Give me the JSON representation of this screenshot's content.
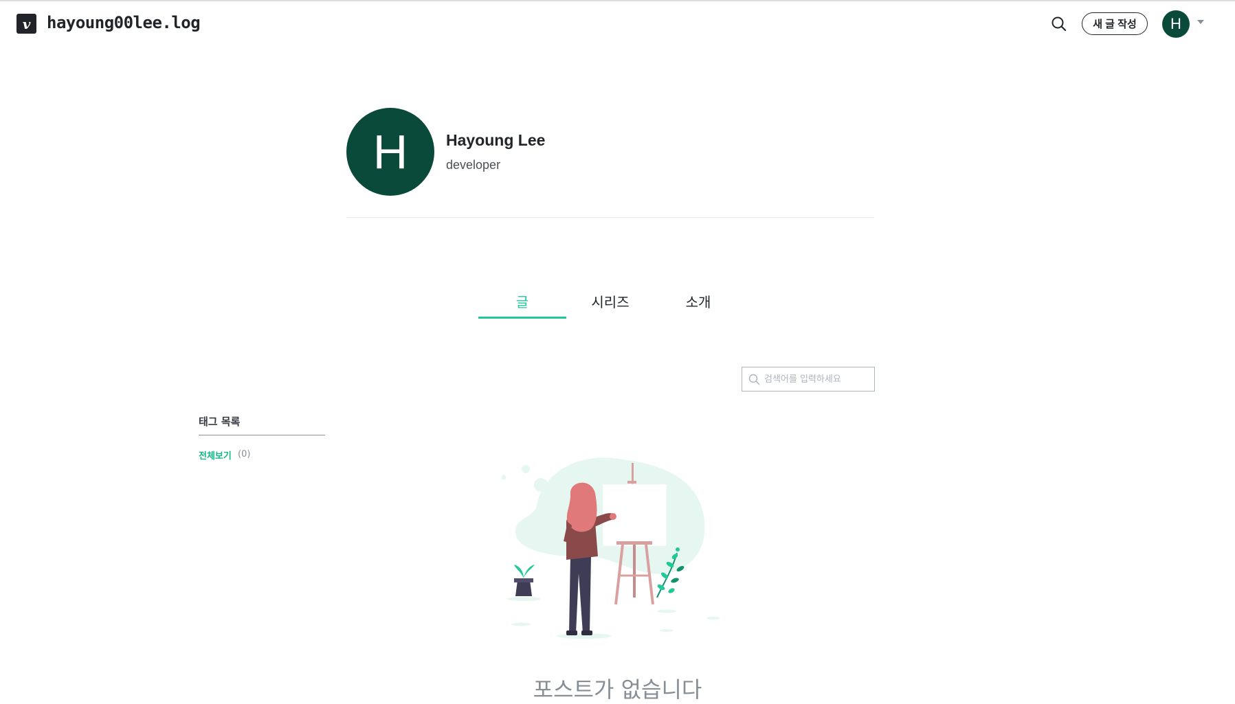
{
  "header": {
    "logo_letter": "v",
    "blog_name": "hayoung00lee.log",
    "new_post_label": "새 글 작성",
    "avatar_letter": "H"
  },
  "profile": {
    "avatar_letter": "H",
    "name": "Hayoung Lee",
    "bio": "developer"
  },
  "tabs": [
    {
      "label": "글",
      "active": true
    },
    {
      "label": "시리즈",
      "active": false
    },
    {
      "label": "소개",
      "active": false
    }
  ],
  "search": {
    "placeholder": "검색어를 입력하세요",
    "value": ""
  },
  "tags": {
    "title": "태그 목록",
    "all_label": "전체보기",
    "all_count": "(0)"
  },
  "empty_state": {
    "message": "포스트가 없습니다"
  },
  "colors": {
    "accent": "#20c997",
    "avatar_bg": "#0a4a3a"
  }
}
